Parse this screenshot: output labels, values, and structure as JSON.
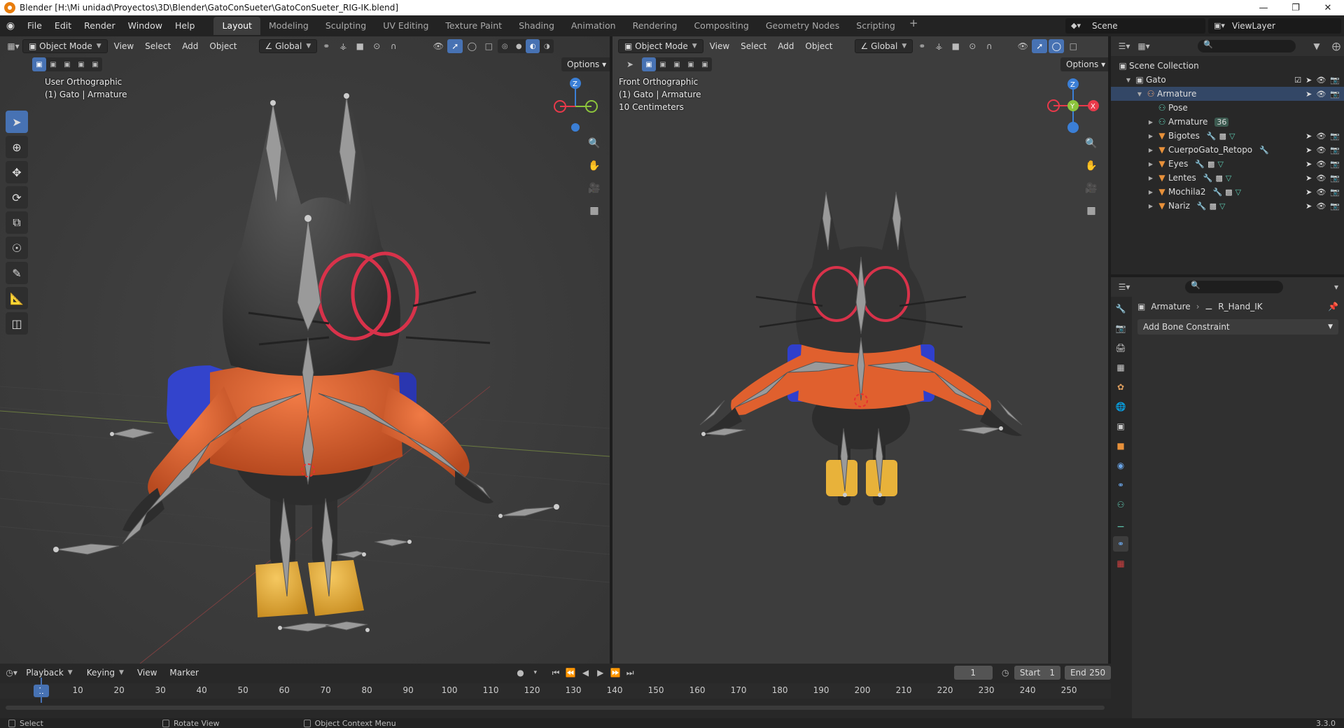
{
  "window": {
    "title": "Blender [H:\\Mi unidad\\Proyectos\\3D\\Blender\\GatoConSueter\\GatoConSueter_RIG-IK.blend]"
  },
  "menu": [
    "File",
    "Edit",
    "Render",
    "Window",
    "Help"
  ],
  "workspaces": [
    "Layout",
    "Modeling",
    "Sculpting",
    "UV Editing",
    "Texture Paint",
    "Shading",
    "Animation",
    "Rendering",
    "Compositing",
    "Geometry Nodes",
    "Scripting"
  ],
  "active_workspace": "Layout",
  "scene": "Scene",
  "view_layer": "ViewLayer",
  "viewport_left": {
    "mode": "Object Mode",
    "menus": [
      "View",
      "Select",
      "Add",
      "Object"
    ],
    "orientation": "Global",
    "options": "Options",
    "view_name": "User Orthographic",
    "object_info": "(1) Gato | Armature"
  },
  "viewport_right": {
    "mode": "Object Mode",
    "menus": [
      "View",
      "Select",
      "Add",
      "Object"
    ],
    "orientation": "Global",
    "options": "Options",
    "view_name": "Front Orthographic",
    "object_info": "(1) Gato | Armature",
    "scale_info": "10 Centimeters"
  },
  "gizmo": {
    "x": "X",
    "y": "Y",
    "z": "Z",
    "x_color": "#e8394a",
    "y_color": "#8cc43c",
    "z_color": "#3b7fd6"
  },
  "outliner": {
    "search_placeholder": "",
    "rows": [
      {
        "label": "Scene Collection",
        "indent": 0,
        "icon": "collection-icon"
      },
      {
        "label": "Gato",
        "indent": 1,
        "icon": "collection-icon"
      },
      {
        "label": "Armature",
        "indent": 2,
        "icon": "armature-object-icon"
      },
      {
        "label": "Pose",
        "indent": 3,
        "icon": "pose-icon"
      },
      {
        "label": "Armature",
        "indent": 3,
        "icon": "armature-data-icon"
      },
      {
        "label": "Bigotes",
        "indent": 3,
        "icon": "mesh-icon"
      },
      {
        "label": "CuerpoGato_Retopo",
        "indent": 3,
        "icon": "mesh-icon"
      },
      {
        "label": "Eyes",
        "indent": 3,
        "icon": "mesh-icon"
      },
      {
        "label": "Lentes",
        "indent": 3,
        "icon": "mesh-icon"
      },
      {
        "label": "Mochila2",
        "indent": 3,
        "icon": "mesh-icon"
      },
      {
        "label": "Nariz",
        "indent": 3,
        "icon": "mesh-icon"
      }
    ],
    "bone_count_badge": "36"
  },
  "properties": {
    "breadcrumb_object": "Armature",
    "breadcrumb_bone": "R_Hand_IK",
    "add_constraint": "Add Bone Constraint"
  },
  "timeline": {
    "menus": [
      "Playback",
      "Keying",
      "View",
      "Marker"
    ],
    "current_frame": "1",
    "start_label": "Start",
    "start": "1",
    "end_label": "End",
    "end": "250",
    "ticks": [
      "10",
      "20",
      "30",
      "40",
      "50",
      "60",
      "70",
      "80",
      "90",
      "100",
      "110",
      "120",
      "130",
      "140",
      "150",
      "160",
      "170",
      "180",
      "190",
      "200",
      "210",
      "220",
      "230",
      "240",
      "250"
    ]
  },
  "statusbar": {
    "select": "Select",
    "rotate": "Rotate View",
    "context": "Object Context Menu",
    "version": "3.3.0"
  },
  "colors": {
    "accent": "#4772b3",
    "sweater": "#e0602e",
    "glasses": "#d8324a",
    "backpack": "#2f3fcc",
    "boots": "#e8b23a"
  }
}
